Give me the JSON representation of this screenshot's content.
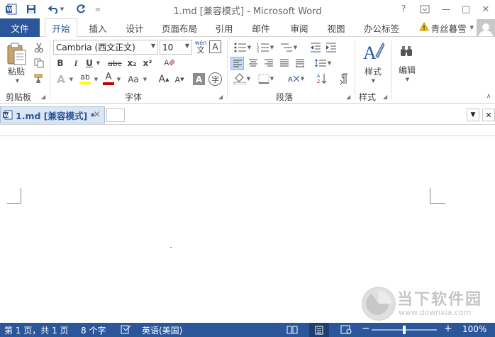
{
  "window": {
    "title": "1.md [兼容模式] - Microsoft Word",
    "help": "?",
    "minimize": "—",
    "restore": "□",
    "close": "✕"
  },
  "quick_access": {
    "customize": "="
  },
  "tabs": [
    {
      "label": "文件"
    },
    {
      "label": "开始"
    },
    {
      "label": "插入"
    },
    {
      "label": "设计"
    },
    {
      "label": "页面布局"
    },
    {
      "label": "引用"
    },
    {
      "label": "邮件"
    },
    {
      "label": "审阅"
    },
    {
      "label": "视图"
    },
    {
      "label": "办公标签"
    }
  ],
  "user": {
    "name": "青丝暮雪"
  },
  "ribbon": {
    "clipboard": {
      "paste_label": "粘贴",
      "group": "剪贴板"
    },
    "font": {
      "font_name": "Cambria (西文正文)",
      "font_size": "10",
      "phonetic": "wén",
      "phonetic_char": "文",
      "border_char": "A",
      "bold": "B",
      "italic": "I",
      "underline": "U",
      "strike": "abc",
      "sub": "x₂",
      "sup": "x²",
      "effects": "A",
      "highlight": "ab",
      "color": "A",
      "case": "Aa",
      "grow": "A",
      "shrink": "A",
      "shading": "A",
      "encircle": "字",
      "group": "字体"
    },
    "paragraph": {
      "group": "段落"
    },
    "styles": {
      "styles_label": "样式",
      "group": "样式"
    },
    "editing": {
      "edit_label": "编辑"
    }
  },
  "document_tabs": [
    {
      "label": "1.md [兼容模式] *",
      "close": "×"
    }
  ],
  "doc_controls": {
    "dropdown": "▼",
    "close": "✕"
  },
  "statusbar": {
    "page": "第 1 页，共 1 页",
    "words": "8 个字",
    "language": "英语(美国)",
    "zoom": "100%"
  },
  "watermark": {
    "site": "当下软件园",
    "url": "www.downxia.com"
  },
  "colors": {
    "accent": "#2b579a",
    "highlight": "#ffff00",
    "font_color": "#c00000"
  }
}
